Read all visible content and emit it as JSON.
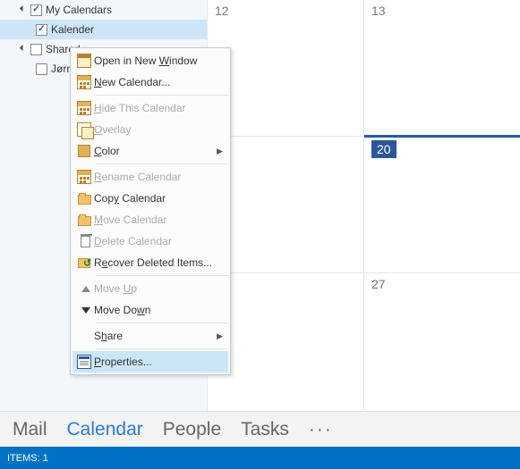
{
  "sidebar": {
    "groups": [
      {
        "label": "My Calendars",
        "checked": true,
        "expanded": true,
        "items": [
          {
            "label": "Kalender",
            "checked": true,
            "selected": true
          }
        ]
      },
      {
        "label": "Shared",
        "checked": false,
        "expanded": true,
        "truncated": true,
        "items": [
          {
            "label": "Jørn",
            "checked": false,
            "truncated": true
          }
        ]
      }
    ]
  },
  "calendar": {
    "rows": [
      {
        "cells": [
          {
            "day": "12"
          },
          {
            "day": "13"
          }
        ]
      },
      {
        "cells": [
          {
            "day": ""
          },
          {
            "day": "20",
            "today": true
          }
        ]
      },
      {
        "cells": [
          {
            "day": ""
          },
          {
            "day": "27"
          }
        ]
      }
    ]
  },
  "context_menu": {
    "items": [
      {
        "key": "open-new-window",
        "pre": "Open in New ",
        "mn": "W",
        "post": "indow",
        "icon": "window"
      },
      {
        "key": "new-calendar",
        "pre": "",
        "mn": "N",
        "post": "ew Calendar...",
        "icon": "cal"
      },
      {
        "sep": true
      },
      {
        "key": "hide-calendar",
        "pre": "",
        "mn": "H",
        "post": "ide This Calendar",
        "icon": "cal",
        "disabled": true
      },
      {
        "key": "overlay",
        "pre": "",
        "mn": "O",
        "post": "verlay",
        "icon": "overlay",
        "disabled": true
      },
      {
        "key": "color",
        "pre": "",
        "mn": "C",
        "post": "olor",
        "icon": "color",
        "submenu": true
      },
      {
        "sep": true
      },
      {
        "key": "rename",
        "pre": "",
        "mn": "R",
        "post": "ename Calendar",
        "icon": "cal",
        "disabled": true
      },
      {
        "key": "copy",
        "pre": "Cop",
        "mn": "y",
        "post": " Calendar",
        "icon": "folder"
      },
      {
        "key": "move",
        "pre": "",
        "mn": "M",
        "post": "ove Calendar",
        "icon": "folder",
        "disabled": true
      },
      {
        "key": "delete",
        "pre": "",
        "mn": "D",
        "post": "elete Calendar",
        "icon": "trash",
        "disabled": true
      },
      {
        "key": "recover",
        "pre": "R",
        "mn": "e",
        "post": "cover Deleted Items...",
        "icon": "recover"
      },
      {
        "sep": true
      },
      {
        "key": "move-up",
        "pre": "Move ",
        "mn": "U",
        "post": "p",
        "icon": "up",
        "disabled": true
      },
      {
        "key": "move-down",
        "pre": "Move Do",
        "mn": "w",
        "post": "n",
        "icon": "down"
      },
      {
        "sep": true
      },
      {
        "key": "share",
        "pre": "S",
        "mn": "h",
        "post": "are",
        "icon": "",
        "submenu": true
      },
      {
        "sep": true
      },
      {
        "key": "properties",
        "pre": "",
        "mn": "P",
        "post": "roperties...",
        "icon": "props",
        "highlight": true
      }
    ]
  },
  "nav": {
    "items": [
      {
        "key": "mail",
        "label": "Mail"
      },
      {
        "key": "calendar",
        "label": "Calendar",
        "active": true
      },
      {
        "key": "people",
        "label": "People"
      },
      {
        "key": "tasks",
        "label": "Tasks"
      }
    ],
    "more": "···"
  },
  "status": {
    "text": "ITEMS: 1"
  }
}
